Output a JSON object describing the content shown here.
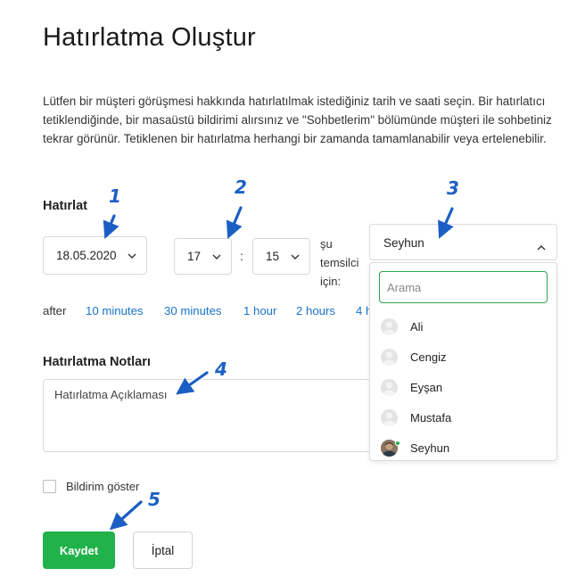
{
  "page": {
    "title": "Hatırlatma Oluştur",
    "description": "Lütfen bir müşteri görüşmesi hakkında hatırlatılmak istediğiniz tarih ve saati seçin. Bir hatırlatıcı tetiklendiğinde, bir masaüstü bildirimi alırsınız ve \"Sohbetlerim\" bölümünde müşteri ile sohbetiniz tekrar görünür. Tetiklenen bir hatırlatma herhangi bir zamanda tamamlanabilir veya ertelenebilir."
  },
  "remind": {
    "label": "Hatırlat",
    "date": "18.05.2020",
    "hour": "17",
    "separator": ":",
    "minute": "15",
    "rep_label": "şu temsilci için:"
  },
  "after": {
    "label": "after",
    "options": [
      "10 minutes",
      "30 minutes",
      "1 hour",
      "2 hours",
      "4 h"
    ]
  },
  "rep_dropdown": {
    "selected": "Seyhun",
    "search_placeholder": "Arama",
    "items": [
      "Ali",
      "Cengiz",
      "Eyşan",
      "Mustafa",
      "Seyhun"
    ]
  },
  "notes": {
    "label": "Hatırlatma Notları",
    "placeholder": "Hatırlatma Açıklaması"
  },
  "notify": {
    "label": "Bildirim göster",
    "checked": false
  },
  "actions": {
    "save": "Kaydet",
    "cancel": "İptal"
  },
  "annotations": [
    "1",
    "2",
    "3",
    "4",
    "5"
  ],
  "colors": {
    "primary_green": "#21b24a",
    "link_blue": "#1a73c9",
    "annotation_blue": "#1c5fc4",
    "search_focus": "#2da44e"
  }
}
